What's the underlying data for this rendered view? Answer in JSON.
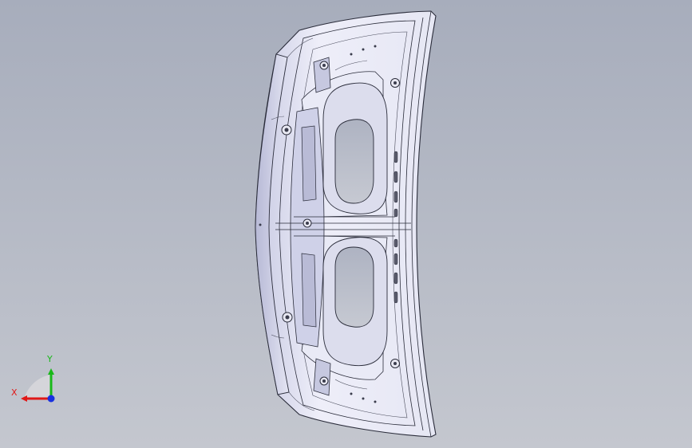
{
  "viewport": {
    "background_top": "#a7adbc",
    "background_bottom": "#c4c7cf",
    "model_name": "trunk-lid-inner-panel"
  },
  "model_colors": {
    "edge": "#2a2c3a",
    "surface_light": "#f3f3fb",
    "surface_mid": "#dedfef",
    "surface_dark": "#b9bbd6",
    "hole_fill": "#c2c6d2"
  },
  "triad": {
    "x_label": "X",
    "y_label": "Y",
    "x_color": "#e01818",
    "y_color": "#18b818",
    "z_color": "#1830e0"
  }
}
